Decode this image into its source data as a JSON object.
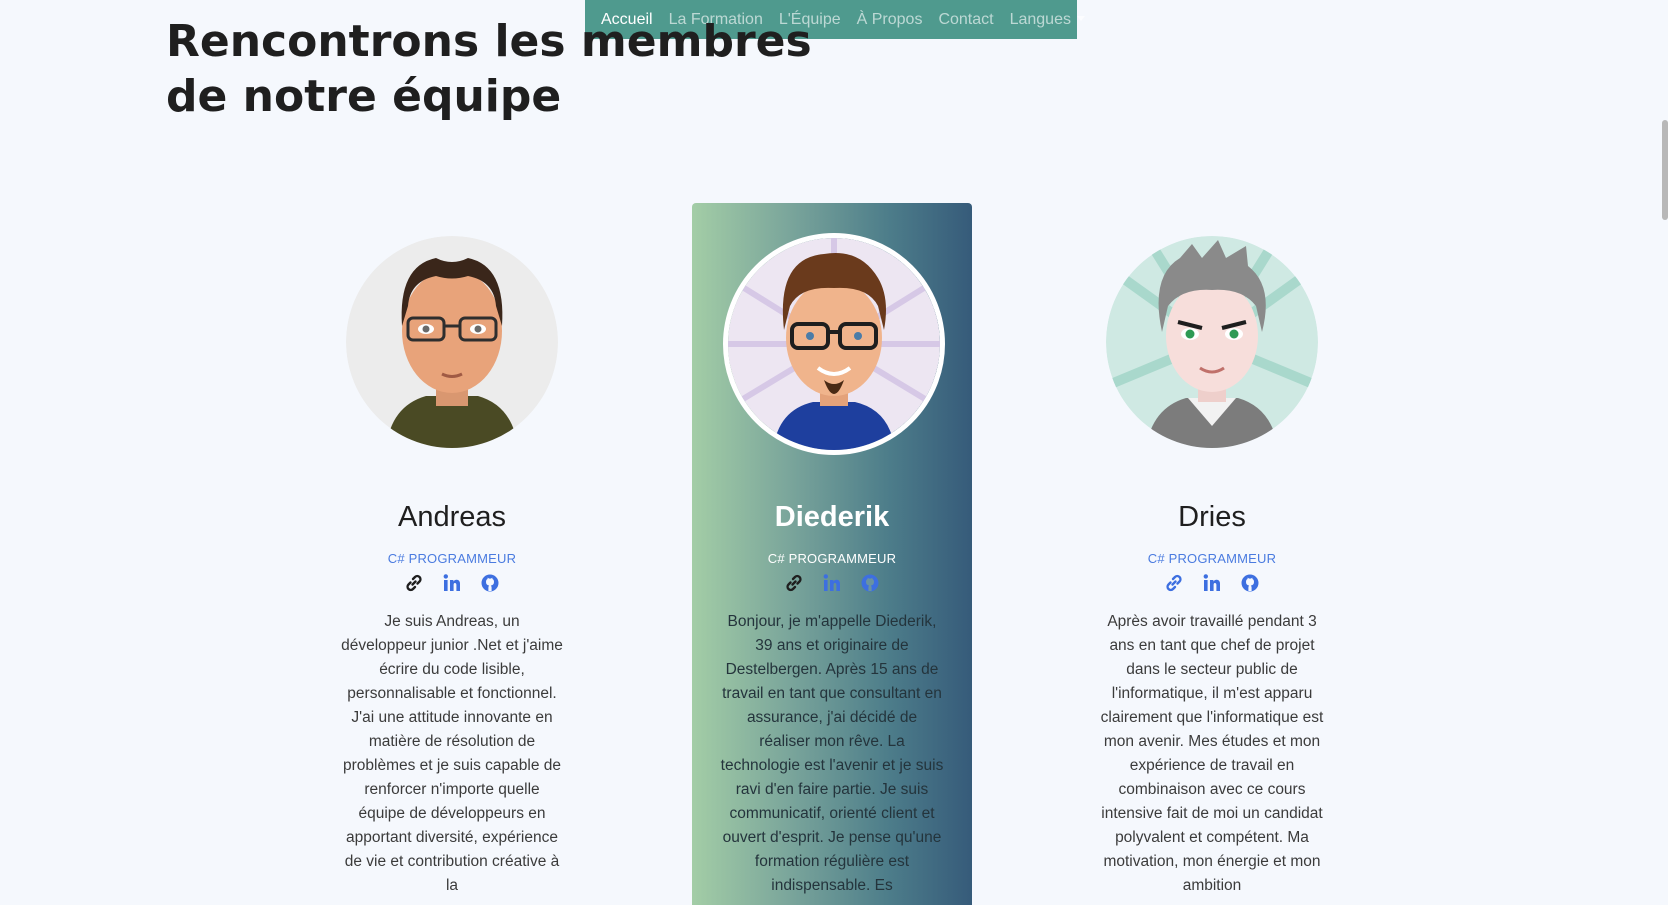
{
  "nav": {
    "items": [
      "Accueil",
      "La Formation",
      "L'Équipe",
      "À Propos",
      "Contact"
    ],
    "languages_label": "Langues",
    "active_color": "#ffffff",
    "bar_color": "#4f9a8e"
  },
  "page": {
    "title_line1": "Rencontrons les membres",
    "title_line2": "de notre équipe"
  },
  "team": [
    {
      "name": "Andreas",
      "role": "C# PROGRAMMEUR",
      "bio": "Je suis Andreas, un développeur junior .Net et j'aime écrire du code lisible, personnalisable et fonctionnel. J'ai une attitude innovante en matière de résolution de problèmes et je suis capable de renforcer n'importe quelle équipe de développeurs en apportant diversité, expérience de vie et contribution créative à la",
      "icons": [
        "link-icon",
        "linkedin-icon",
        "github-icon"
      ]
    },
    {
      "name": "Diederik",
      "role": "C# PROGRAMMEUR",
      "bio": "Bonjour, je m'appelle Diederik, 39 ans et originaire de Destelbergen. Après 15 ans de travail en tant que consultant en assurance, j'ai décidé de réaliser mon rêve. La technologie est l'avenir et je suis ravi d'en faire partie. Je suis communicatif, orienté client et ouvert d'esprit. Je pense qu'une formation régulière est indispensable. Es",
      "icons": [
        "link-icon",
        "linkedin-icon",
        "github-icon"
      ]
    },
    {
      "name": "Dries",
      "role": "C# PROGRAMMEUR",
      "bio": "Après avoir travaillé pendant 3 ans en tant que chef de projet dans le secteur public de l'informatique, il m'est apparu clairement que l'informatique est mon avenir. Mes études et mon expérience de travail en combinaison avec ce cours intensive fait de moi un candidat polyvalent et compétent. Ma motivation, mon énergie et mon ambition",
      "icons": [
        "link-icon",
        "linkedin-icon",
        "github-icon"
      ]
    }
  ],
  "colors": {
    "role_text": "#4a7be0",
    "link_icon": "#1f1f1f",
    "social_icon": "#3d6fe0"
  }
}
